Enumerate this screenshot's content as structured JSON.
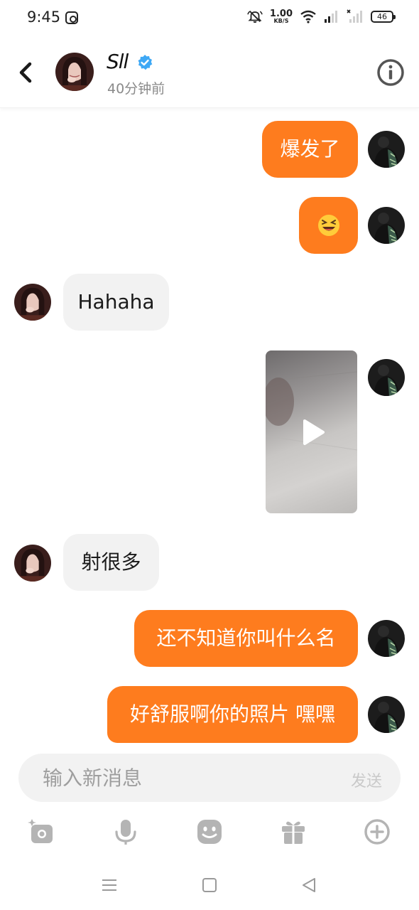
{
  "status_bar": {
    "time": "9:45",
    "net_speed_value": "1.00",
    "net_speed_unit": "KB/S",
    "battery": "46"
  },
  "header": {
    "contact_name": "Sll",
    "last_seen": "40分钟前",
    "icons": [
      "back-arrow-icon",
      "verified-badge-icon",
      "info-icon"
    ]
  },
  "messages": [
    {
      "direction": "out",
      "text": "爆发了"
    },
    {
      "direction": "out",
      "text": "😆"
    },
    {
      "direction": "in",
      "text": "Hahaha"
    },
    {
      "direction": "out",
      "type": "video"
    },
    {
      "direction": "in",
      "text": "射很多"
    },
    {
      "direction": "out",
      "text": "还不知道你叫什么名"
    },
    {
      "direction": "out",
      "text": "好舒服啊你的照片 嘿嘿"
    }
  ],
  "composer": {
    "placeholder": "输入新消息",
    "send_label": "发送"
  },
  "toolbar": {
    "icons": [
      "camera-icon",
      "microphone-icon",
      "emoji-icon",
      "gift-icon",
      "plus-circle-icon"
    ]
  },
  "nav_bar": {
    "icons": [
      "menu-icon",
      "home-square-icon",
      "back-triangle-icon"
    ]
  },
  "colors": {
    "outgoing_bubble": "#fe7c1e",
    "incoming_bubble": "#f2f2f2",
    "verified": "#3ea8f5"
  }
}
